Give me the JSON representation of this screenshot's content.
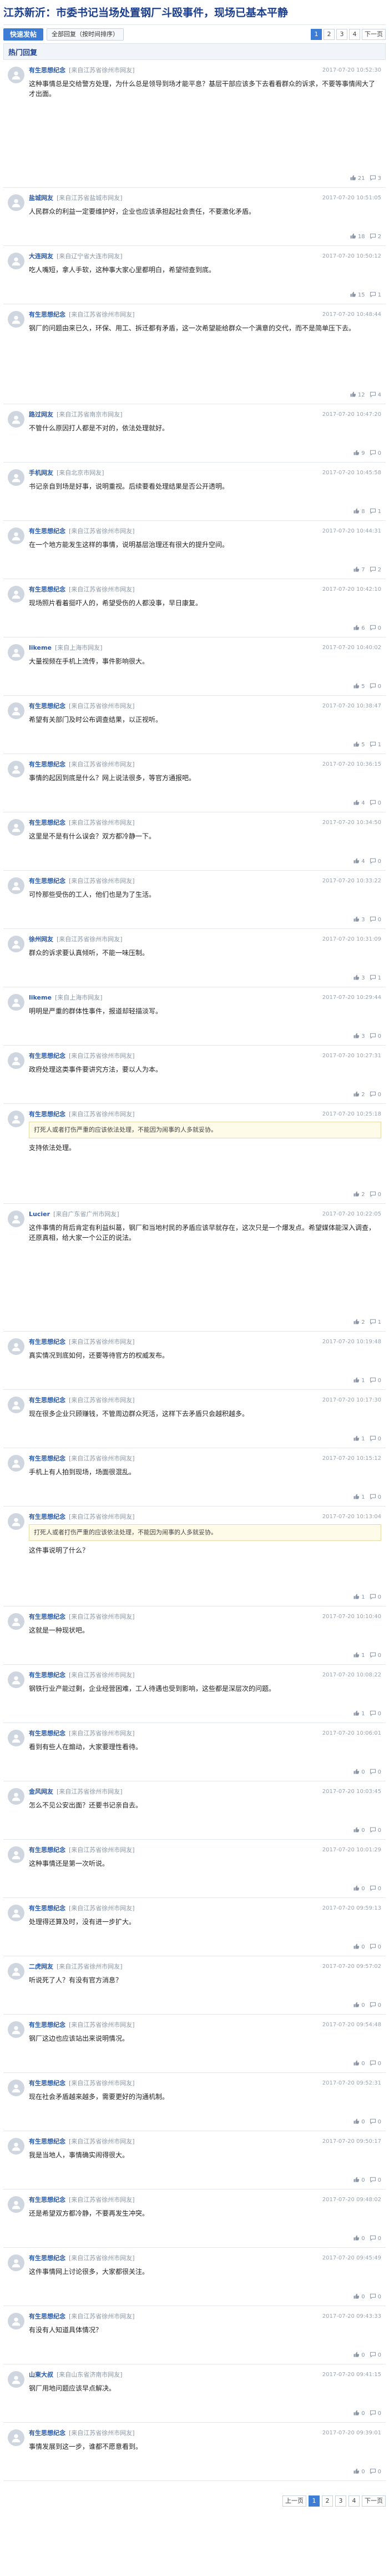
{
  "page": {
    "title": "江苏新沂：市委书记当场处置钢厂斗殴事件，现场已基本平静",
    "reply_button": "快速发帖",
    "view_all_button": "全部回复（按时间排序）",
    "section_title": "热门回复",
    "pages": [
      "1",
      "2",
      "3",
      "4"
    ],
    "next": "下一页",
    "footer_prev": "上一页",
    "footer_next": "下一页"
  },
  "posts": [
    {
      "user": "有生思想纪念",
      "loc": "[来自江苏省徐州市网友]",
      "time": "2017-07-20 10:52:30",
      "text": "这种事情总是交给警方处理，为什么总是领导到场才能平息？基层干部应该多下去看看群众的诉求，不要等事情闹大了才出面。",
      "likes": "21",
      "replies": "3",
      "tall": "xtall"
    },
    {
      "user": "盐城网友",
      "loc": "[来自江苏省盐城市网友]",
      "time": "2017-07-20 10:51:05",
      "text": "人民群众的利益一定要维护好，企业也应该承担起社会责任，不要激化矛盾。",
      "likes": "18",
      "replies": "2",
      "tall": ""
    },
    {
      "user": "大连网友",
      "loc": "[来自辽宁省大连市网友]",
      "time": "2017-07-20 10:50:12",
      "text": "吃人嘴短，拿人手软，这种事大家心里都明白，希望彻查到底。",
      "likes": "15",
      "replies": "1",
      "tall": ""
    },
    {
      "user": "有生思想纪念",
      "loc": "[来自江苏省徐州市网友]",
      "time": "2017-07-20 10:48:44",
      "text": "钢厂的问题由来已久，环保、用工、拆迁都有矛盾，这一次希望能给群众一个满意的交代，而不是简单压下去。",
      "likes": "12",
      "replies": "4",
      "tall": "tall"
    },
    {
      "user": "路过网友",
      "loc": "[来自江苏省南京市网友]",
      "time": "2017-07-20 10:47:20",
      "text": "不管什么原因打人都是不对的，依法处理就好。",
      "likes": "9",
      "replies": "0",
      "tall": ""
    },
    {
      "user": "手机网友",
      "loc": "[来自北京市网友]",
      "time": "2017-07-20 10:45:58",
      "text": "书记亲自到场是好事，说明重视。后续要看处理结果是否公开透明。",
      "likes": "8",
      "replies": "1",
      "tall": ""
    },
    {
      "user": "有生思想纪念",
      "loc": "[来自江苏省徐州市网友]",
      "time": "2017-07-20 10:44:31",
      "text": "在一个地方能发生这样的事情，说明基层治理还有很大的提升空间。",
      "likes": "7",
      "replies": "2",
      "tall": ""
    },
    {
      "user": "有生思想纪念",
      "loc": "[来自江苏省徐州市网友]",
      "time": "2017-07-20 10:42:10",
      "text": "现场照片看着挺吓人的，希望受伤的人都没事，早日康复。",
      "likes": "6",
      "replies": "0",
      "tall": ""
    },
    {
      "user": "likeme",
      "loc": "[来自上海市网友]",
      "time": "2017-07-20 10:40:02",
      "text": "大量视频在手机上流传，事件影响很大。",
      "likes": "5",
      "replies": "0",
      "tall": ""
    },
    {
      "user": "有生思想纪念",
      "loc": "[来自江苏省徐州市网友]",
      "time": "2017-07-20 10:38:47",
      "text": "希望有关部门及时公布调查结果，以正视听。",
      "likes": "5",
      "replies": "1",
      "tall": ""
    },
    {
      "user": "有生思想纪念",
      "loc": "[来自江苏省徐州市网友]",
      "time": "2017-07-20 10:36:15",
      "text": "事情的起因到底是什么？网上说法很多，等官方通报吧。",
      "likes": "4",
      "replies": "0",
      "tall": ""
    },
    {
      "user": "有生思想纪念",
      "loc": "[来自江苏省徐州市网友]",
      "time": "2017-07-20 10:34:50",
      "text": "这里是不是有什么误会？双方都冷静一下。",
      "likes": "4",
      "replies": "0",
      "tall": ""
    },
    {
      "user": "有生思想纪念",
      "loc": "[来自江苏省徐州市网友]",
      "time": "2017-07-20 10:33:22",
      "text": "可怜那些受伤的工人，他们也是为了生活。",
      "likes": "3",
      "replies": "0",
      "tall": ""
    },
    {
      "user": "徐州网友",
      "loc": "[来自江苏省徐州市网友]",
      "time": "2017-07-20 10:31:09",
      "text": "群众的诉求要认真倾听，不能一味压制。",
      "likes": "3",
      "replies": "1",
      "tall": ""
    },
    {
      "user": "likeme",
      "loc": "[来自上海市网友]",
      "time": "2017-07-20 10:29:44",
      "text": "明明是严重的群体性事件，报道却轻描淡写。",
      "likes": "3",
      "replies": "0",
      "tall": ""
    },
    {
      "user": "有生思想纪念",
      "loc": "[来自江苏省徐州市网友]",
      "time": "2017-07-20 10:27:31",
      "text": "政府处理这类事件要讲究方法，要以人为本。",
      "likes": "2",
      "replies": "0",
      "tall": ""
    },
    {
      "user": "有生思想纪念",
      "loc": "[来自江苏省徐州市网友]",
      "time": "2017-07-20 10:25:18",
      "text": "支持依法处理。",
      "likes": "2",
      "replies": "0",
      "quote": "打死人或者打伤严重的应该依法处理，不能因为闹事的人多就妥协。",
      "tall": "tall"
    },
    {
      "user": "Lucier",
      "loc": "[来自广东省广州市网友]",
      "time": "2017-07-20 10:22:05",
      "text": "这件事情的背后肯定有利益纠葛，钢厂和当地村民的矛盾应该早就存在，这次只是一个爆发点。希望媒体能深入调查，还原真相，给大家一个公正的说法。",
      "likes": "2",
      "replies": "1",
      "tall": "xtall"
    },
    {
      "user": "有生思想纪念",
      "loc": "[来自江苏省徐州市网友]",
      "time": "2017-07-20 10:19:48",
      "text": "真实情况到底如何，还要等待官方的权威发布。",
      "likes": "1",
      "replies": "0",
      "tall": ""
    },
    {
      "user": "有生思想纪念",
      "loc": "[来自江苏省徐州市网友]",
      "time": "2017-07-20 10:17:30",
      "text": "现在很多企业只顾赚钱，不管周边群众死活，这样下去矛盾只会越积越多。",
      "likes": "1",
      "replies": "0",
      "tall": ""
    },
    {
      "user": "有生思想纪念",
      "loc": "[来自江苏省徐州市网友]",
      "time": "2017-07-20 10:15:12",
      "text": "手机上有人拍到现场，场面很混乱。",
      "likes": "1",
      "replies": "0",
      "tall": ""
    },
    {
      "user": "有生思想纪念",
      "loc": "[来自江苏省徐州市网友]",
      "time": "2017-07-20 10:13:04",
      "text": "这件事说明了什么？",
      "likes": "1",
      "replies": "0",
      "quote": "打死人或者打伤严重的应该依法处理，不能因为闹事的人多就妥协。",
      "tall": "tall"
    },
    {
      "user": "有生思想纪念",
      "loc": "[来自江苏省徐州市网友]",
      "time": "2017-07-20 10:10:40",
      "text": "这就是一种现状吧。",
      "likes": "1",
      "replies": "0",
      "tall": ""
    },
    {
      "user": "有生思想纪念",
      "loc": "[来自江苏省徐州市网友]",
      "time": "2017-07-20 10:08:22",
      "text": "钢铁行业产能过剩，企业经营困难，工人待遇也受到影响，这些都是深层次的问题。",
      "likes": "1",
      "replies": "0",
      "tall": ""
    },
    {
      "user": "有生思想纪念",
      "loc": "[来自江苏省徐州市网友]",
      "time": "2017-07-20 10:06:01",
      "text": "看到有些人在煽动，大家要理性看待。",
      "likes": "0",
      "replies": "0",
      "tall": ""
    },
    {
      "user": "金风网友",
      "loc": "[来自江苏省徐州市网友]",
      "time": "2017-07-20 10:03:45",
      "text": "怎么不见公安出面？还要书记亲自去。",
      "likes": "0",
      "replies": "0",
      "tall": ""
    },
    {
      "user": "有生思想纪念",
      "loc": "[来自江苏省徐州市网友]",
      "time": "2017-07-20 10:01:29",
      "text": "这种事情还是第一次听说。",
      "likes": "0",
      "replies": "0",
      "tall": ""
    },
    {
      "user": "有生思想纪念",
      "loc": "[来自江苏省徐州市网友]",
      "time": "2017-07-20 09:59:13",
      "text": "处理得还算及时，没有进一步扩大。",
      "likes": "0",
      "replies": "0",
      "tall": ""
    },
    {
      "user": "二虎网友",
      "loc": "[来自江苏省徐州市网友]",
      "time": "2017-07-20 09:57:02",
      "text": "听说死了人？有没有官方消息？",
      "likes": "0",
      "replies": "0",
      "tall": ""
    },
    {
      "user": "有生思想纪念",
      "loc": "[来自江苏省徐州市网友]",
      "time": "2017-07-20 09:54:48",
      "text": "钢厂这边也应该站出来说明情况。",
      "likes": "0",
      "replies": "0",
      "tall": ""
    },
    {
      "user": "有生思想纪念",
      "loc": "[来自江苏省徐州市网友]",
      "time": "2017-07-20 09:52:31",
      "text": "现在社会矛盾越来越多，需要更好的沟通机制。",
      "likes": "0",
      "replies": "0",
      "tall": ""
    },
    {
      "user": "有生思想纪念",
      "loc": "[来自江苏省徐州市网友]",
      "time": "2017-07-20 09:50:17",
      "text": "我是当地人，事情确实闹得很大。",
      "likes": "0",
      "replies": "0",
      "tall": ""
    },
    {
      "user": "有生思想纪念",
      "loc": "[来自江苏省徐州市网友]",
      "time": "2017-07-20 09:48:02",
      "text": "还是希望双方都冷静，不要再发生冲突。",
      "likes": "0",
      "replies": "0",
      "tall": ""
    },
    {
      "user": "有生思想纪念",
      "loc": "[来自江苏省徐州市网友]",
      "time": "2017-07-20 09:45:49",
      "text": "这件事情网上讨论很多，大家都很关注。",
      "likes": "0",
      "replies": "0",
      "tall": ""
    },
    {
      "user": "有生思想纪念",
      "loc": "[来自江苏省徐州市网友]",
      "time": "2017-07-20 09:43:33",
      "text": "有没有人知道具体情况？",
      "likes": "0",
      "replies": "0",
      "tall": ""
    },
    {
      "user": "山東大叔",
      "loc": "[来自山东省济南市网友]",
      "time": "2017-07-20 09:41:15",
      "text": "钢厂用地问题应该早点解决。",
      "likes": "0",
      "replies": "0",
      "tall": ""
    },
    {
      "user": "有生思想纪念",
      "loc": "[来自江苏省徐州市网友]",
      "time": "2017-07-20 09:39:01",
      "text": "事情发展到这一步，谁都不愿意看到。",
      "likes": "0",
      "replies": "0",
      "tall": ""
    }
  ]
}
